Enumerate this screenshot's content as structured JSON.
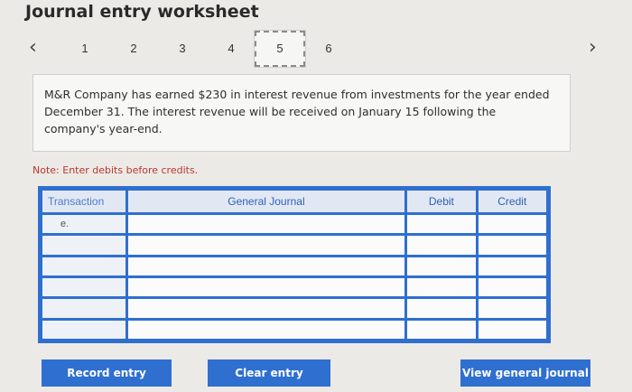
{
  "title": "Journal entry worksheet",
  "pager": {
    "prev_icon": "‹",
    "next_icon": "›",
    "pages": [
      "1",
      "2",
      "3",
      "4",
      "5",
      "6"
    ],
    "active": "5"
  },
  "question": "M&R Company has earned $230 in interest revenue from investments for the year ended December 31. The interest revenue will be received on January 15 following the company's year-end.",
  "note": "Note: Enter debits before credits.",
  "table": {
    "headers": [
      "Transaction",
      "General Journal",
      "Debit",
      "Credit"
    ],
    "first_row_transaction": "e."
  },
  "buttons": {
    "record": "Record entry",
    "clear": "Clear entry",
    "view": "View general journal"
  }
}
